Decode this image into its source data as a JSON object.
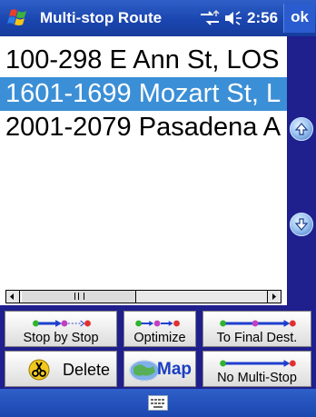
{
  "titlebar": {
    "title": "Multi-stop Route",
    "time": "2:56",
    "ok_label": "ok"
  },
  "list": {
    "items": [
      {
        "text": "100-298 E Ann St, LOS",
        "selected": false
      },
      {
        "text": "1601-1699 Mozart St, L",
        "selected": true
      },
      {
        "text": "2001-2079 Pasadena A",
        "selected": false
      }
    ]
  },
  "buttons": {
    "stop_by_stop": "Stop by Stop",
    "optimize": "Optimize",
    "to_final_dest": "To Final Dest.",
    "delete": "Delete",
    "map": "Map",
    "no_multi_stop": "No Multi-Stop"
  },
  "colors": {
    "titlebar": "#1b46b0",
    "selection": "#3b8fd6",
    "panel": "#1f1f8e"
  }
}
